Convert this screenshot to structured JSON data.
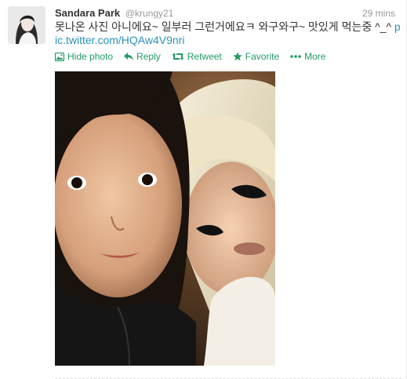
{
  "tweet": {
    "fullname": "Sandara Park",
    "username": "@krungy21",
    "time": "29 mins",
    "text_before_link": "못나온 사진 아니에요~ 일부러 그런거에요ㅋ 와구와구~ 맛있게 먹는중 ^_^ ",
    "link": "pic.twitter.com/HQAw4V9nri",
    "avatar_icon": "profile-photo"
  },
  "actions": {
    "hide_photo": "Hide photo",
    "reply": "Reply",
    "retweet": "Retweet",
    "favorite": "Favorite",
    "more": "More"
  },
  "icons": {
    "photo": "photo-icon",
    "reply": "reply-arrow-icon",
    "retweet": "retweet-icon",
    "favorite": "star-icon",
    "more": "ellipsis-icon"
  },
  "colors": {
    "action_green": "#229a65",
    "link_blue": "#2a91b8",
    "name": "#333333",
    "meta_gray": "#999999"
  }
}
